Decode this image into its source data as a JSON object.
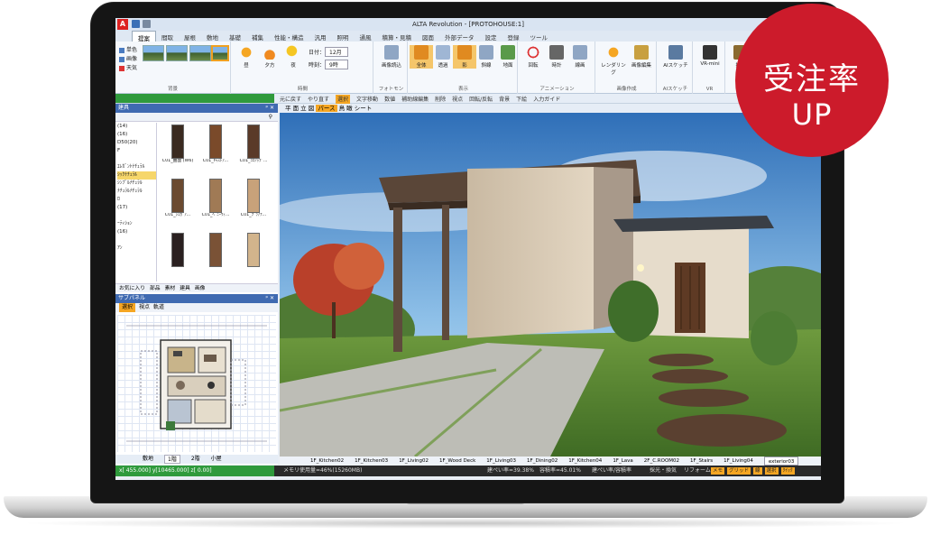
{
  "app": {
    "title": "ALTA Revolution - [PROTOHOUSE:1]",
    "logo_letter": "A"
  },
  "badge": {
    "line1": "受注率",
    "line2": "UP"
  },
  "ribbon_tabs": [
    "提案",
    "間取",
    "屋根",
    "敷地",
    "基礎",
    "補集",
    "性能・構造",
    "汎用",
    "照明",
    "通風",
    "積算・見積",
    "図面",
    "外部データ",
    "設定",
    "登録",
    "ツール"
  ],
  "ribbon": {
    "background_group": {
      "name": "背景",
      "options": [
        "単色",
        "画像",
        "天気"
      ]
    },
    "time_group": {
      "name": "時間",
      "buttons": [
        "昼",
        "夕方",
        "夜"
      ],
      "date_label": "日付：",
      "date_value": "12月",
      "time_label": "時刻：",
      "time_value": "9時"
    },
    "photomon_group": {
      "name": "フォトモン",
      "buttons": [
        "画像読込"
      ]
    },
    "display_group": {
      "name": "表示",
      "buttons": [
        "全体",
        "透過",
        "影",
        "斜線",
        "地面"
      ]
    },
    "animation_group": {
      "name": "アニメーション",
      "buttons": [
        "回転",
        "時計",
        "線画"
      ]
    },
    "image_group": {
      "name": "画像作成",
      "buttons": [
        "レンダリング",
        "画像編集"
      ]
    },
    "ai_group": {
      "name": "AIスケッチ",
      "buttons": [
        "AIスケッチ"
      ]
    },
    "vr_group": {
      "name": "VR",
      "buttons": [
        "VR-mini"
      ]
    },
    "last_group": {
      "buttons": [
        "撮影"
      ]
    }
  },
  "toolbar2": {
    "items": [
      "元に戻す",
      "やり直す",
      "選択",
      "文字移動",
      "数値",
      "補助線編集",
      "削除",
      "視点",
      "回転/反転",
      "背景",
      "下絵",
      "入力ガイド"
    ],
    "selected": "選択"
  },
  "library": {
    "title": "建具",
    "close": "ᵖ ✕",
    "categories": [
      "(14)",
      "(16)",
      "D50(20)",
      "F",
      "",
      "ｴﾚｶﾞﾝﾄﾅﾁｭﾗﾙ",
      "ｼｯｸﾅﾁｭﾗﾙ",
      "ｼﾝﾌﾟﾙﾅﾁｭﾗﾙ",
      "ﾅﾁｭﾗﾙﾅﾁｭﾗﾙ",
      "ﾛ",
      "(17)",
      "",
      "ｰﾃｨｼｮﾝ",
      "(16)",
      "",
      "ｱﾝ"
    ],
    "selected_category": "ｼｯｸﾅﾁｭﾗﾙ",
    "items": [
      {
        "caption": "C01_曲面\n(W6)",
        "color": "#3a2a20"
      },
      {
        "caption": "C01_ｷｬｽﾄｱ...",
        "color": "#7a4a2a"
      },
      {
        "caption": "C01_ｺｺｱｯﾌﾟ...",
        "color": "#5a3a28"
      },
      {
        "caption": "C01_ｼｭｶﾞｱ...",
        "color": "#6b4a30"
      },
      {
        "caption": "C01_ﾍﾞﾆｰｳｨ...",
        "color": "#a07a55"
      },
      {
        "caption": "C01_ﾌﾟﾗｱﾅ...",
        "color": "#c8a27a"
      },
      {
        "caption": "",
        "color": "#2a2020"
      },
      {
        "caption": "",
        "color": "#7a5236"
      },
      {
        "caption": "",
        "color": "#d2b48c"
      }
    ],
    "tabs": [
      "お気に入り",
      "部品",
      "素材",
      "建具",
      "画像"
    ]
  },
  "subpanel": {
    "title": "サブパネル",
    "tabs": [
      "選択",
      "視点",
      "軌道"
    ],
    "selected_tab": "選択",
    "floor_tabs": [
      "敷地",
      "1階",
      "2階",
      "小屋"
    ],
    "selected_floor": "1階"
  },
  "view": {
    "modes": [
      "平",
      "面",
      "立",
      "図"
    ],
    "active_mode": "パース",
    "extra": [
      "鳥",
      "瞰",
      "シート"
    ]
  },
  "scene_tabs": [
    "1F_Kitchen02",
    "1F_Kitchen03",
    "1F_Living02",
    "1F_Wood Deck",
    "1F_Living03",
    "1F_Dining02",
    "1F_Kitchen04",
    "1F_Lava",
    "2F_C.ROOM02",
    "1F_Stairs",
    "1F_Living04",
    "exterior03"
  ],
  "selected_scene": "exterior03",
  "status": {
    "coords": "x[  455.000] y[10465.000] z[    0.00]",
    "memory": "メモリ使用量=46%(15260MB)",
    "s1": "建ぺい率=39.38%",
    "s2": "容積率=45.01%",
    "s3": "建ぺい率/容積率",
    "s4": "採光・換気",
    "s5": "リフォーム",
    "buttons": [
      "メモ",
      "グリッド",
      "線",
      "選択",
      "ｸｲｯｸ"
    ]
  },
  "colors": {
    "badge": "#cc1b2b",
    "accent": "#f5a623",
    "panel_header": "#3f6ab1",
    "status_green": "#2f9a3c"
  }
}
